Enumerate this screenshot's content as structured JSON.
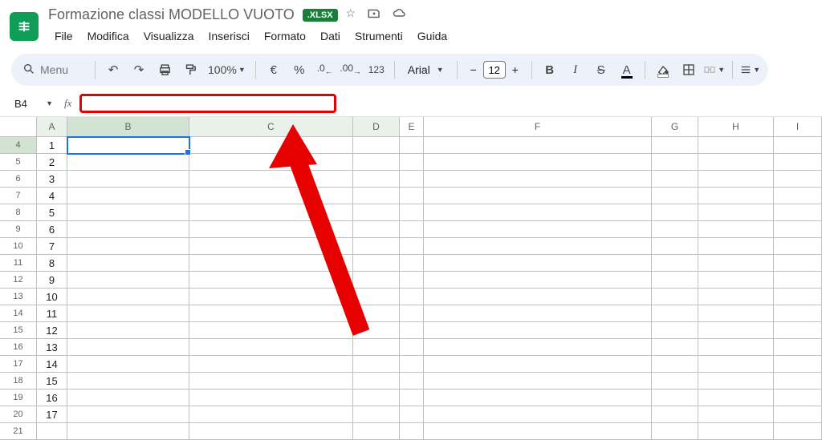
{
  "header": {
    "title": "Formazione classi MODELLO VUOTO",
    "badge": ".XLSX"
  },
  "menus": [
    "File",
    "Modifica",
    "Visualizza",
    "Inserisci",
    "Formato",
    "Dati",
    "Strumenti",
    "Guida"
  ],
  "toolbar": {
    "search_placeholder": "Menu",
    "zoom": "100%",
    "font": "Arial",
    "font_size": "12",
    "currency": "€",
    "percent": "%",
    "dec_dec": ".0",
    "dec_inc": ".00",
    "num_fmt": "123"
  },
  "namebox": "B4",
  "columns": [
    "A",
    "B",
    "C",
    "D",
    "E",
    "F",
    "G",
    "H",
    "I"
  ],
  "col_classes": [
    "cA",
    "cB",
    "cC",
    "cD",
    "cE",
    "cF",
    "cG",
    "cH",
    "cI"
  ],
  "col_header_styles": [
    "hl",
    "sel",
    "hl",
    "hl",
    "",
    "",
    "",
    "",
    ""
  ],
  "row_start": 4,
  "row_end": 21,
  "selected_row": 4,
  "selected_cell": "B4",
  "colA_values": {
    "4": "1",
    "5": "2",
    "6": "3",
    "7": "4",
    "8": "5",
    "9": "6",
    "10": "7",
    "11": "8",
    "12": "9",
    "13": "10",
    "14": "11",
    "15": "12",
    "16": "13",
    "17": "14",
    "18": "15",
    "19": "16",
    "20": "17"
  }
}
